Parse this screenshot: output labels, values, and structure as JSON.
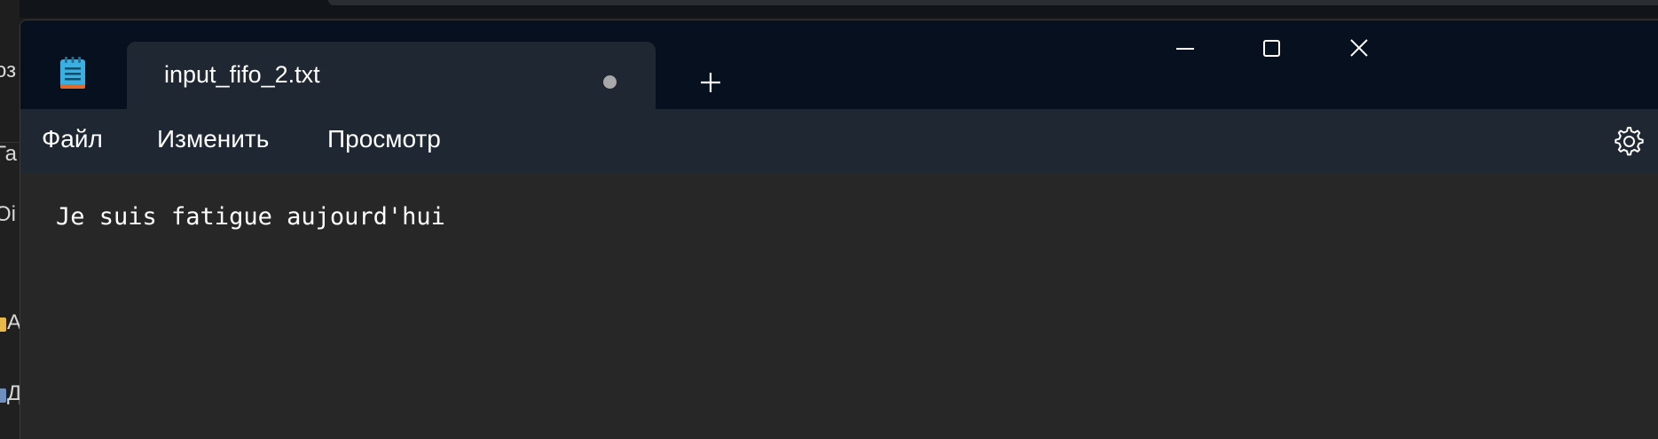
{
  "background_window": {
    "fragments": [
      "оз",
      "Га",
      "Оі",
      "А",
      "Д"
    ]
  },
  "tab": {
    "title": "input_fifo_2.txt",
    "unsaved": true
  },
  "window_controls": {
    "minimize_icon": "minimize-icon",
    "maximize_icon": "maximize-icon",
    "close_icon": "close-icon"
  },
  "menu": {
    "file": "Файл",
    "edit": "Изменить",
    "view": "Просмотр"
  },
  "editor": {
    "content": "Je suis fatigue aujourd'hui"
  },
  "colors": {
    "titlebar": "#06101f",
    "tab": "#1f2733",
    "editor_bg": "#272727",
    "text": "#ffffff",
    "app_icon": "#3ab0e2"
  }
}
